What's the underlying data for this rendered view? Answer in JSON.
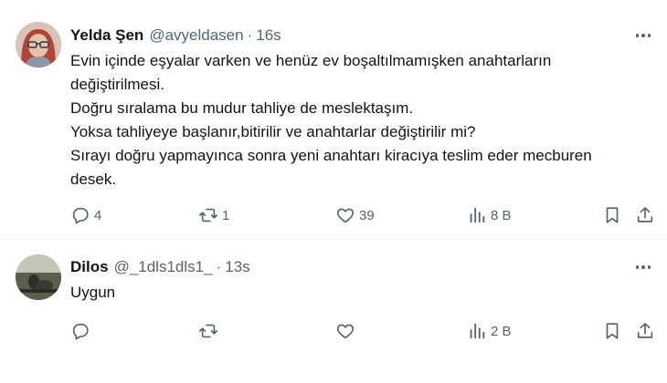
{
  "tweets": [
    {
      "author_name": "Yelda Şen",
      "handle": "@avyeldasen",
      "separator": "·",
      "time": "16s",
      "text": "Evin içinde eşyalar varken ve henüz ev boşaltılmamışken anahtarların\ndeğiştirilmesi.\nDoğru sıralama bu mudur tahliye de meslektaşım.\nYoksa tahliyeye başlanır,bitirilir ve anahtarlar değiştirilir mi?\nSırayı doğru yapmayınca sonra yeni anahtarı kiracıya teslim eder mecburen\ndesek.",
      "replies": "4",
      "retweets": "1",
      "likes": "39",
      "views": "8 B"
    },
    {
      "author_name": "Dilos",
      "handle": "@_1dls1dls1_",
      "separator": "·",
      "time": "13s",
      "text": "Uygun",
      "replies": "",
      "retweets": "",
      "likes": "",
      "views": "2 B"
    }
  ],
  "icons": {
    "reply": "reply-icon",
    "retweet": "retweet-icon",
    "like": "heart-icon",
    "views": "views-icon",
    "bookmark": "bookmark-icon",
    "share": "share-icon",
    "more": "more-icon"
  },
  "colors": {
    "text": "#0f1419",
    "secondary": "#536471",
    "divider": "#eff3f4"
  }
}
